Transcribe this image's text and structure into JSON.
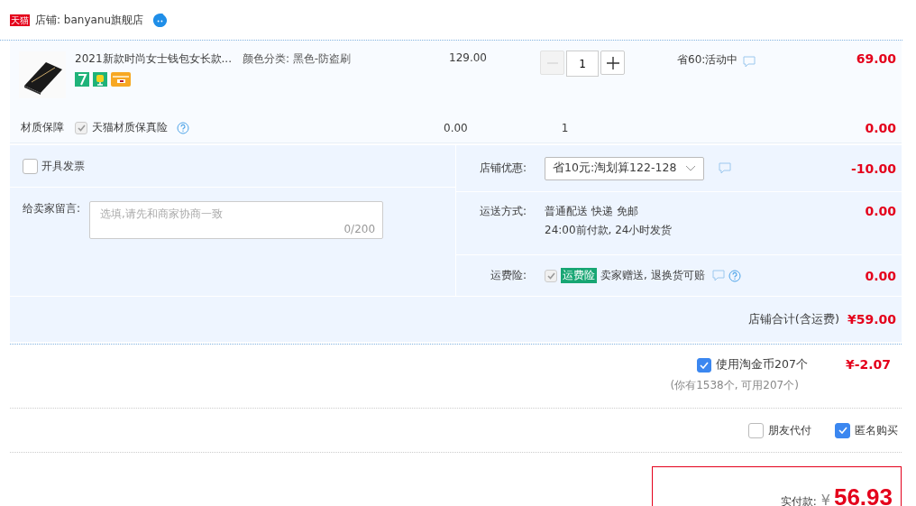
{
  "store": {
    "badge": "天猫",
    "name": "店铺: banyanu旗舰店"
  },
  "item": {
    "title": "2021新款时尚女士钱包女长款...",
    "sku": "颜色分类: 黑色-防盗刷",
    "price": "129.00",
    "quantity": "1",
    "promo": "省60:活动中",
    "subtotal": "69.00"
  },
  "warranty": {
    "label": "材质保障",
    "option": "天猫材质保真险",
    "checked": true,
    "disabled": true,
    "price": "0.00",
    "quantity": "1",
    "subtotal": "0.00"
  },
  "invoice": {
    "label": "开具发票",
    "checked": false
  },
  "message": {
    "label": "给卖家留言:",
    "placeholder": "选填,请先和商家协商一致",
    "counter": "0/200"
  },
  "discount": {
    "label": "店铺优惠:",
    "value": "省10元:淘划算122-128",
    "amount": "-10.00"
  },
  "shipping": {
    "label": "运送方式:",
    "line_1": "普通配送 快递 免邮",
    "line_2": "24:00前付款, 24小时发货",
    "amount": "0.00"
  },
  "insurance": {
    "label": "运费险:",
    "tag": "运费险",
    "text": "卖家赠送, 退换货可赔",
    "checked": true,
    "disabled": true,
    "amount": "0.00"
  },
  "store_total": {
    "label": "店铺合计(含运费)",
    "amount": "¥59.00"
  },
  "coins": {
    "label": "使用淘金币207个",
    "checked": true,
    "note": "(你有1538个, 可用207个)",
    "amount": "¥-2.07"
  },
  "options": [
    {
      "label": "朋友代付",
      "checked": false
    },
    {
      "label": "匿名购买",
      "checked": true
    }
  ],
  "payment": {
    "label": "实付款:",
    "currency": "¥",
    "amount": "56.93"
  }
}
